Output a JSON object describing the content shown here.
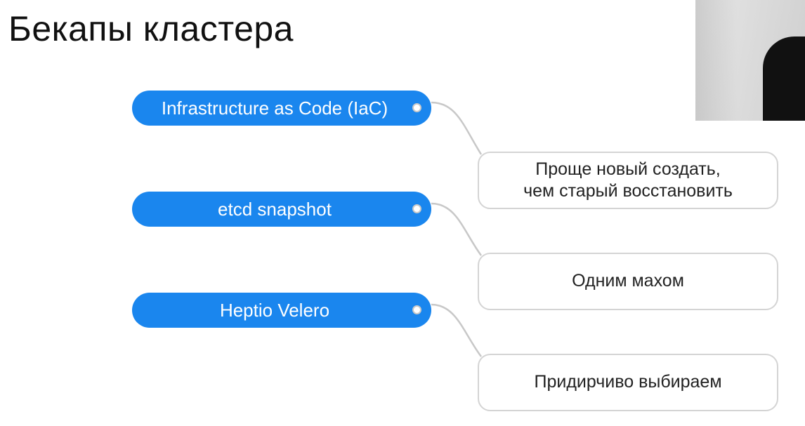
{
  "slide": {
    "title": "Бекапы кластера"
  },
  "colors": {
    "pill_background": "#1a86ee",
    "pill_text": "#ffffff",
    "box_border": "#d4d4d4",
    "connector": "#c8c8c8"
  },
  "diagram": {
    "nodes": [
      {
        "label": "Infrastructure as Code (IaC)",
        "note_lines": [
          "Проще новый создать,",
          "чем старый восстановить"
        ]
      },
      {
        "label": "etcd snapshot",
        "note_lines": [
          "Одним махом"
        ]
      },
      {
        "label": "Heptio Velero",
        "note_lines": [
          "Придирчиво выбираем"
        ]
      }
    ]
  },
  "webcam": {
    "icon": "webcam-feed-image"
  }
}
